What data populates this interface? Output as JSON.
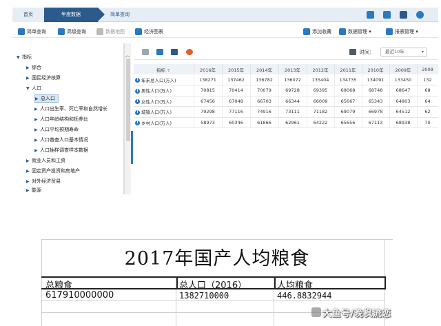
{
  "nav": {
    "home": "首页",
    "annual": "年度数据",
    "simple": "简单查询"
  },
  "toolbar": {
    "simple_query": "简单查询",
    "advanced_query": "高级查询",
    "data_map": "数据地图",
    "econ_chart": "经济图表",
    "add_favorite": "添加收藏",
    "data_manage": "数据管理",
    "report_manage": "报表管理"
  },
  "sidebar": {
    "root": "指标",
    "items": [
      "综合",
      "国民经济核算",
      "人口",
      "总人口",
      "人口出生率、死亡率和自然增长",
      "人口年龄结构和抚养比",
      "人口平均预期寿命",
      "人口普查人口基本情况",
      "人口抽样调查样本数据",
      "就业人员和工资",
      "固定资产投资和房地产",
      "对外经济贸易",
      "能源"
    ]
  },
  "panel": {
    "time_label": "时间：",
    "time_value": "最近10年"
  },
  "table": {
    "header_indicator": "指标",
    "years": [
      "2016年",
      "2015年",
      "2014年",
      "2013年",
      "2012年",
      "2011年",
      "2010年",
      "2009年",
      "2008"
    ],
    "rows": [
      {
        "name": "年末总人口(万人)",
        "values": [
          "138271",
          "137462",
          "136782",
          "136072",
          "135404",
          "134735",
          "134091",
          "133450",
          "132"
        ]
      },
      {
        "name": "男性人口(万人)",
        "values": [
          "70815",
          "70414",
          "70079",
          "69728",
          "69395",
          "69068",
          "68748",
          "68647",
          "68"
        ]
      },
      {
        "name": "女性人口(万人)",
        "values": [
          "67456",
          "67048",
          "66703",
          "66344",
          "66009",
          "65667",
          "65343",
          "64803",
          "64"
        ]
      },
      {
        "name": "城镇人口(万人)",
        "values": [
          "79298",
          "77116",
          "74916",
          "73111",
          "71182",
          "69079",
          "66978",
          "64512",
          "62"
        ]
      },
      {
        "name": "乡村人口(万人)",
        "values": [
          "58973",
          "60346",
          "61866",
          "62961",
          "64222",
          "65656",
          "67113",
          "68938",
          "70"
        ]
      }
    ]
  },
  "sheet": {
    "title": "2017年国产人均粮食",
    "headers": [
      "总粮食",
      "总人口（2016）",
      "人均粮食"
    ],
    "values": [
      "617910000000",
      "1382710000",
      "446.8832944"
    ]
  },
  "watermark": "大鱼号/晚枫流恋"
}
